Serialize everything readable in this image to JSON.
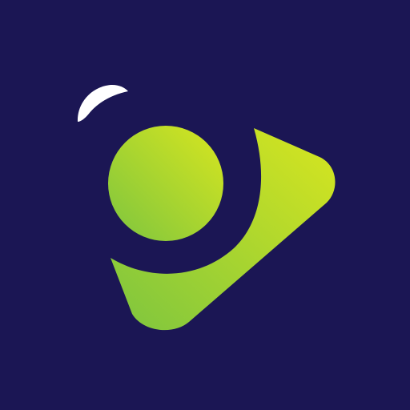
{
  "logo": {
    "icon": "play-button-eye-icon",
    "colors": {
      "background": "#1b1654",
      "gradient_top": "#d8e61f",
      "gradient_bottom": "#7dc53f",
      "highlight": "#ffffff"
    }
  }
}
